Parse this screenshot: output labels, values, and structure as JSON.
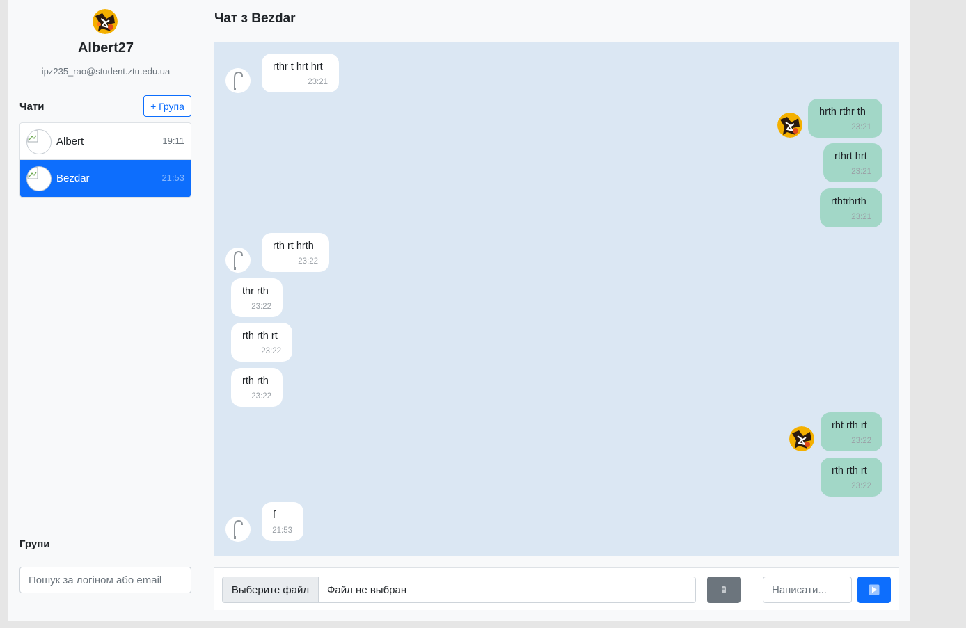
{
  "profile": {
    "username": "Albert27",
    "email": "ipz235_rao@student.ztu.edu.ua",
    "avatar_icon": "fiery-avatar-icon"
  },
  "sidebar": {
    "chats_heading": "Чати",
    "add_group_label": "+ Група",
    "chats": [
      {
        "name": "Albert",
        "time": "19:11",
        "active": false
      },
      {
        "name": "Bezdar",
        "time": "21:53",
        "active": true
      }
    ],
    "groups_heading": "Групи",
    "search_placeholder": "Пошук за логіном або email"
  },
  "chat": {
    "title": "Чат з Bezdar",
    "messages": [
      {
        "dir": "in",
        "text": "rthr t hrt hrt",
        "time": "23:21",
        "avatar": true
      },
      {
        "dir": "out",
        "text": "hrth rthr th",
        "time": "23:21",
        "avatar": true
      },
      {
        "dir": "out",
        "text": "rthrt hrt",
        "time": "23:21",
        "avatar": false
      },
      {
        "dir": "out",
        "text": "rthtrhrth",
        "time": "23:21",
        "avatar": false
      },
      {
        "dir": "in",
        "text": "rth rt hrth",
        "time": "23:22",
        "avatar": true
      },
      {
        "dir": "in",
        "text": "thr rth",
        "time": "23:22",
        "avatar": false
      },
      {
        "dir": "in",
        "text": "rth rth rt",
        "time": "23:22",
        "avatar": false
      },
      {
        "dir": "in",
        "text": "rth rth",
        "time": "23:22",
        "avatar": false
      },
      {
        "dir": "out",
        "text": "rht rth rt",
        "time": "23:22",
        "avatar": true
      },
      {
        "dir": "out",
        "text": "rth rth rt",
        "time": "23:22",
        "avatar": false
      },
      {
        "dir": "in",
        "text": "f",
        "time": "21:53",
        "avatar": true
      }
    ]
  },
  "composer": {
    "file_button_label": "Выберите файл",
    "file_status": "Файл не выбран",
    "emoji_icon": "emoji-icon",
    "message_placeholder": "Написати...",
    "send_icon": "send-arrow-icon"
  },
  "colors": {
    "accent": "#0d6efd",
    "chat_background": "#dbe7f3",
    "outgoing_bubble": "#a2d7c7",
    "incoming_bubble": "#ffffff"
  }
}
